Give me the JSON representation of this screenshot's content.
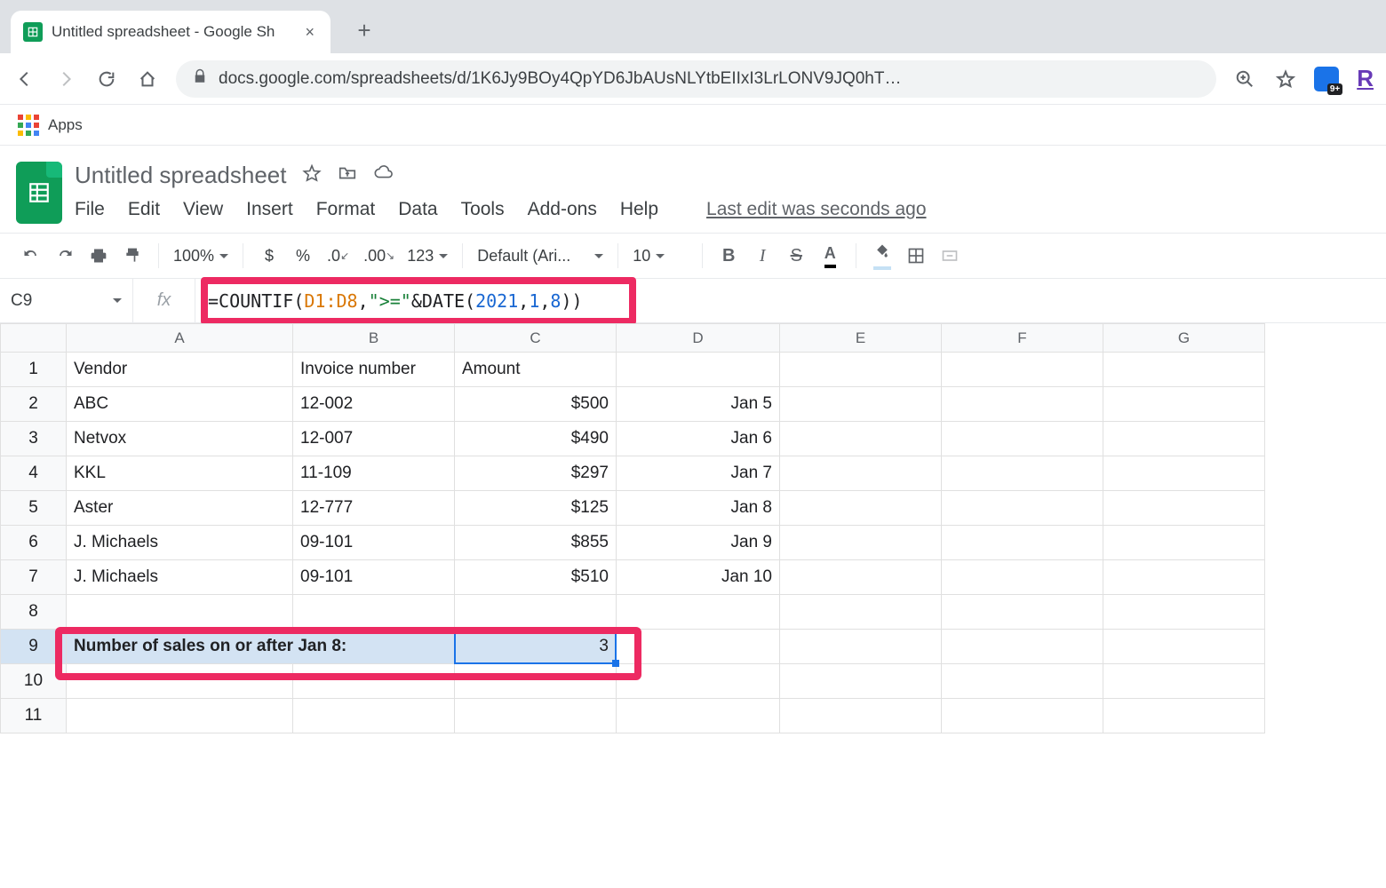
{
  "browser": {
    "tab_title": "Untitled spreadsheet - Google Sh",
    "url": "docs.google.com/spreadsheets/d/1K6Jy9BOy4QpYD6JbAUsNLYtbEIIxI3LrLONV9JQ0hT…",
    "apps_label": "Apps",
    "ext_badge": "9+",
    "r_label": "R"
  },
  "doc": {
    "title": "Untitled spreadsheet",
    "menus": [
      "File",
      "Edit",
      "View",
      "Insert",
      "Format",
      "Data",
      "Tools",
      "Add-ons",
      "Help"
    ],
    "last_edit": "Last edit was seconds ago"
  },
  "toolbar": {
    "zoom": "100%",
    "font_name": "Default (Ari...",
    "font_size": "10",
    "currency": "$",
    "percent": "%",
    "dec_dec": ".0",
    "inc_dec": ".00",
    "num_fmt": "123"
  },
  "formula_bar": {
    "cell_ref": "C9",
    "fx": "fx",
    "prefix": "=",
    "fn1": "COUNTIF",
    "open": "(",
    "range": "D1:D8",
    "comma1": ",",
    "str": "\">=\"",
    "amp": "&",
    "fn2": "DATE",
    "open2": "(",
    "n1": "2021",
    "c2": ",",
    "n2": "1",
    "c3": ",",
    "n3": "8",
    "close2": ")",
    "close": ")"
  },
  "grid": {
    "cols": [
      "A",
      "B",
      "C",
      "D",
      "E",
      "F",
      "G"
    ],
    "rows": {
      "1": {
        "A": "Vendor",
        "B": "Invoice number",
        "C": "Amount",
        "D": ""
      },
      "2": {
        "A": "ABC",
        "B": "12-002",
        "C": "$500",
        "D": "Jan 5"
      },
      "3": {
        "A": "Netvox",
        "B": "12-007",
        "C": "$490",
        "D": "Jan 6"
      },
      "4": {
        "A": "KKL",
        "B": "11-109",
        "C": "$297",
        "D": "Jan 7"
      },
      "5": {
        "A": "Aster",
        "B": "12-777",
        "C": "$125",
        "D": "Jan 8"
      },
      "6": {
        "A": "J. Michaels",
        "B": "09-101",
        "C": "$855",
        "D": "Jan 9"
      },
      "7": {
        "A": "J. Michaels",
        "B": "09-101",
        "C": "$510",
        "D": "Jan 10"
      },
      "8": {
        "A": "",
        "B": "",
        "C": "",
        "D": ""
      },
      "9": {
        "A": "Number of sales on or after Jan 8:",
        "B": "",
        "C": "3",
        "D": ""
      },
      "10": {
        "A": "",
        "B": "",
        "C": "",
        "D": ""
      },
      "11": {
        "A": "",
        "B": "",
        "C": "",
        "D": ""
      }
    }
  }
}
